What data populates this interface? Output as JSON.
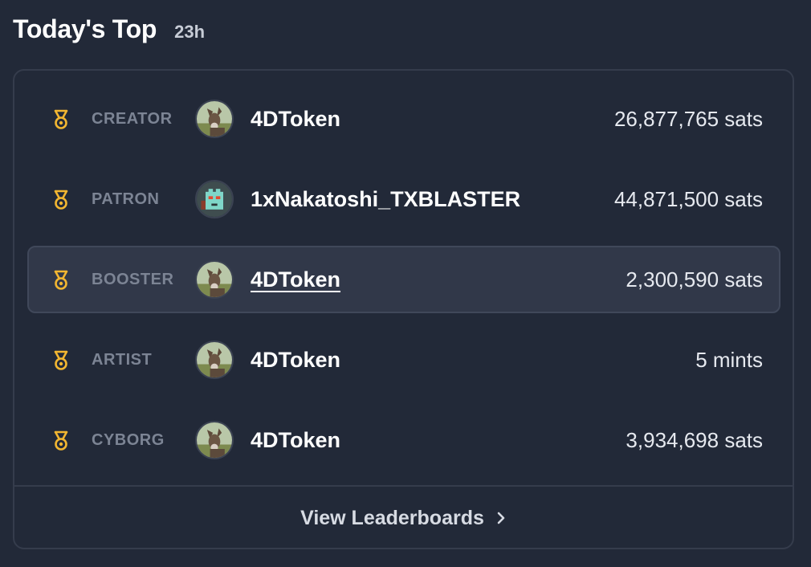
{
  "header": {
    "title": "Today's Top",
    "period": "23h"
  },
  "rows": [
    {
      "category": "CREATOR",
      "username": "4DToken",
      "amount": "26,877,765 sats",
      "avatar": "donkey-avatar-icon"
    },
    {
      "category": "PATRON",
      "username": "1xNakatoshi_TXBLASTER",
      "amount": "44,871,500 sats",
      "avatar": "pixel-robot-avatar-icon"
    },
    {
      "category": "BOOSTER",
      "username": "4DToken",
      "amount": "2,300,590 sats",
      "avatar": "donkey-avatar-icon"
    },
    {
      "category": "ARTIST",
      "username": "4DToken",
      "amount": "5 mints",
      "avatar": "donkey-avatar-icon"
    },
    {
      "category": "CYBORG",
      "username": "4DToken",
      "amount": "3,934,698 sats",
      "avatar": "donkey-avatar-icon"
    }
  ],
  "footer": {
    "label": "View Leaderboards",
    "icon": "chevron-right-icon"
  },
  "colors": {
    "background": "#222938",
    "medal": "#f2b631",
    "selected_row": "#313849",
    "border": "#353c4c"
  }
}
